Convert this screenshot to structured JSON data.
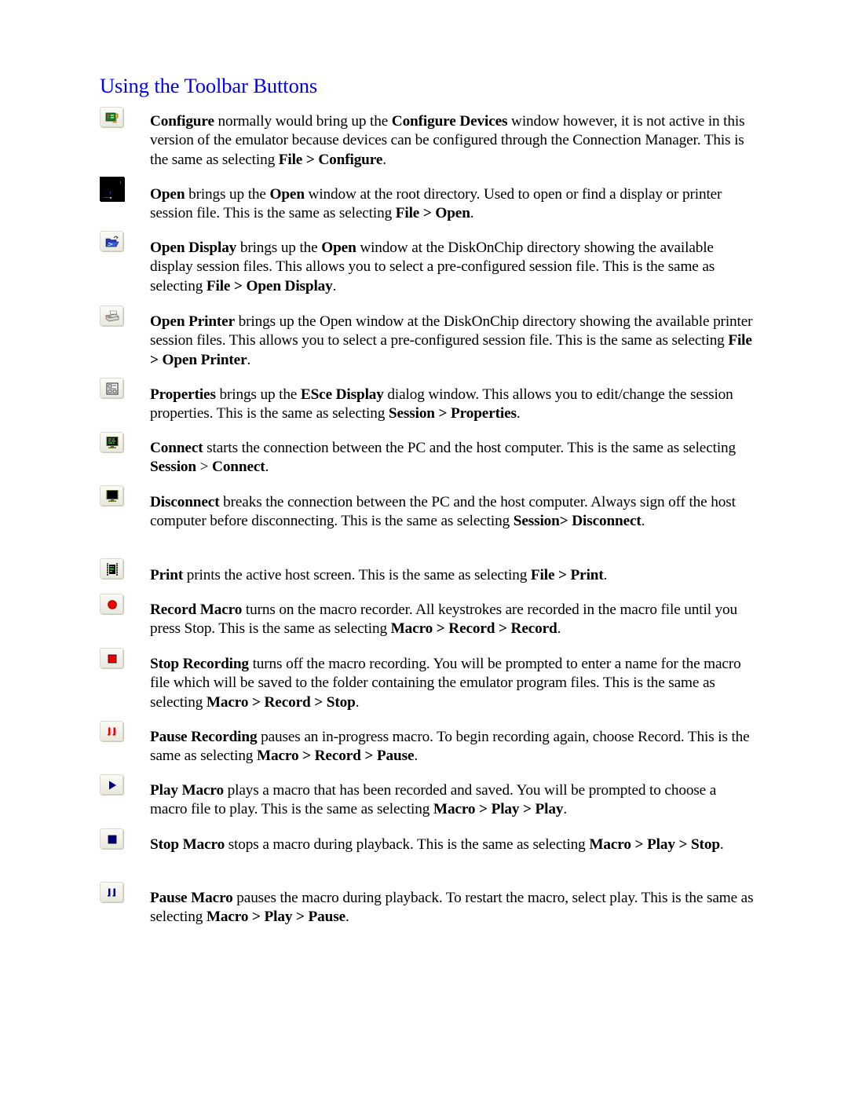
{
  "page": {
    "title": "Using the Toolbar Buttons",
    "title_color": "#0000ff"
  },
  "entries": [
    {
      "icon": "configure-devices-icon",
      "segments": [
        {
          "t": "Configure",
          "b": true
        },
        {
          "t": " normally would bring up the ",
          "b": false
        },
        {
          "t": "Configure Devices",
          "b": true
        },
        {
          "t": " window however, it is not active in this version of the emulator because devices can be configured through the Connection Manager.  This is the same as selecting ",
          "b": false
        },
        {
          "t": "File > Configure",
          "b": true
        },
        {
          "t": ".",
          "b": false
        }
      ]
    },
    {
      "icon": "open-icon",
      "segments": [
        {
          "t": "Open",
          "b": true
        },
        {
          "t": " brings up the ",
          "b": false
        },
        {
          "t": "Open",
          "b": true
        },
        {
          "t": " window at the root directory.  Used to open or find a display or printer session file.  This is the same as selecting ",
          "b": false
        },
        {
          "t": "File > Open",
          "b": true
        },
        {
          "t": ".",
          "b": false
        }
      ]
    },
    {
      "icon": "open-display-folder-icon",
      "segments": [
        {
          "t": "Open Display",
          "b": true
        },
        {
          "t": " brings up the ",
          "b": false
        },
        {
          "t": "Open",
          "b": true
        },
        {
          "t": " window at the DiskOnChip directory showing the available display session files.  This allows you to select a pre-configured session file. This is the same as selecting ",
          "b": false
        },
        {
          "t": "File > Open Display",
          "b": true
        },
        {
          "t": ".",
          "b": false
        }
      ]
    },
    {
      "icon": "open-printer-icon",
      "segments": [
        {
          "t": "Open Printer",
          "b": true
        },
        {
          "t": " brings up the Open window at the DiskOnChip directory showing the available printer session files.  This allows you to select a pre-configured session file. This is the same as selecting ",
          "b": false
        },
        {
          "t": "File > Open Printer",
          "b": true
        },
        {
          "t": ".",
          "b": false
        }
      ]
    },
    {
      "icon": "properties-icon",
      "segments": [
        {
          "t": "Properties",
          "b": true
        },
        {
          "t": " brings up the ",
          "b": false
        },
        {
          "t": "ESce Display",
          "b": true
        },
        {
          "t": " dialog window.  This allows you to edit/change the session properties.  This is the same as selecting ",
          "b": false
        },
        {
          "t": "Session > Properties",
          "b": true
        },
        {
          "t": ".",
          "b": false
        }
      ]
    },
    {
      "icon": "connect-monitor-icon",
      "segments": [
        {
          "t": "Connect",
          "b": true
        },
        {
          "t": " starts the connection between the PC and the host computer.  This is the same as selecting ",
          "b": false
        },
        {
          "t": "Session",
          "b": true
        },
        {
          "t": " > ",
          "b": false
        },
        {
          "t": "Connect",
          "b": true
        },
        {
          "t": ".",
          "b": false
        }
      ]
    },
    {
      "icon": "disconnect-monitor-icon",
      "segments": [
        {
          "t": "Disconnect",
          "b": true
        },
        {
          "t": " breaks the connection between the PC and the host computer.  Always sign off the host computer before disconnecting.  This is the same as selecting ",
          "b": false
        },
        {
          "t": "Session> Disconnect",
          "b": true
        },
        {
          "t": ".",
          "b": false
        }
      ]
    },
    {
      "icon": "print-screen-icon",
      "segments": [
        {
          "t": "Print",
          "b": true
        },
        {
          "t": " prints the active host screen.  This is the same as selecting ",
          "b": false
        },
        {
          "t": "File > Print",
          "b": true
        },
        {
          "t": ".",
          "b": false
        }
      ]
    },
    {
      "icon": "record-macro-icon",
      "segments": [
        {
          "t": "Record Macro",
          "b": true
        },
        {
          "t": " turns on the macro recorder.  All keystrokes are recorded in the macro file until you press Stop.  This is the same as selecting ",
          "b": false
        },
        {
          "t": "Macro > Record > Record",
          "b": true
        },
        {
          "t": ".",
          "b": false
        }
      ]
    },
    {
      "icon": "stop-recording-icon",
      "segments": [
        {
          "t": "Stop Recording",
          "b": true
        },
        {
          "t": " turns off the macro recording.  You will be prompted to enter a name for the macro file which will be saved to the folder containing the emulator program files. This is the same as selecting ",
          "b": false
        },
        {
          "t": "Macro > Record > Stop",
          "b": true
        },
        {
          "t": ".",
          "b": false
        }
      ]
    },
    {
      "icon": "pause-recording-icon",
      "segments": [
        {
          "t": "Pause Recording",
          "b": true
        },
        {
          "t": " pauses an in-progress macro. To begin recording again, choose Record.  This is the same as selecting ",
          "b": false
        },
        {
          "t": "Macro > Record > Pause",
          "b": true
        },
        {
          "t": ".",
          "b": false
        }
      ]
    },
    {
      "icon": "play-macro-icon",
      "segments": [
        {
          "t": "Play Macro",
          "b": true
        },
        {
          "t": " plays a macro that has been recorded and saved.  You will be prompted to choose a macro file to play.  This is the same as selecting ",
          "b": false
        },
        {
          "t": "Macro > Play > Play",
          "b": true
        },
        {
          "t": ".",
          "b": false
        }
      ]
    },
    {
      "icon": "stop-macro-icon",
      "segments": [
        {
          "t": "Stop Macro",
          "b": true
        },
        {
          "t": " stops a macro during playback.  This is the same as selecting ",
          "b": false
        },
        {
          "t": "Macro > Play > Stop",
          "b": true
        },
        {
          "t": ".",
          "b": false
        }
      ]
    },
    {
      "icon": "pause-macro-icon",
      "segments": [
        {
          "t": "Pause Macro",
          "b": true
        },
        {
          "t": " pauses the macro during playback.  To restart the macro, select play.  This is the same as selecting ",
          "b": false
        },
        {
          "t": "Macro > Play > Pause",
          "b": true
        },
        {
          "t": ".",
          "b": false
        }
      ]
    }
  ],
  "colors": {
    "record_red": "#ee0000",
    "macro_blue": "#000080",
    "screen_green": "#1a9a2a"
  }
}
